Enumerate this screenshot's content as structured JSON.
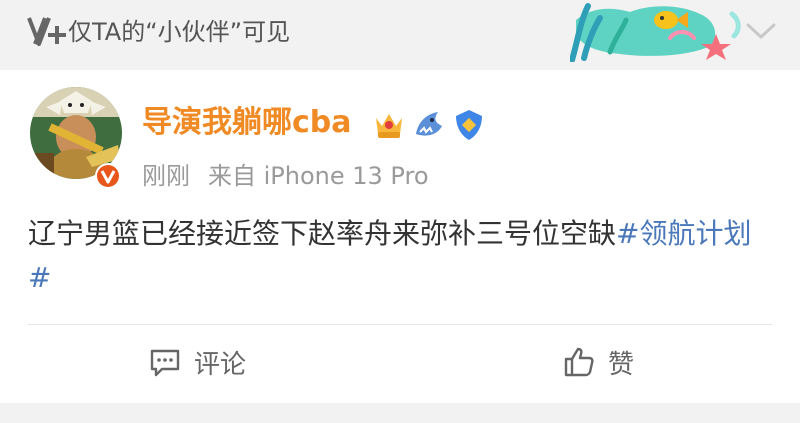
{
  "header": {
    "visibility_label": "仅TA的“小伙伴”可见"
  },
  "post": {
    "author": "导演我躺哪cba",
    "time": "刚刚",
    "source": "来自 iPhone 13 Pro",
    "text": "辽宁男篮已经接近签下赵率舟来弥补三号位空缺",
    "hashtag": "#领航计划#"
  },
  "actions": {
    "comment_label": "评论",
    "like_label": "赞"
  },
  "icons": {
    "visibility": "eye-v-plus-icon",
    "decor": "fish-coral-decoration",
    "chevron": "chevron-down-icon",
    "verified": "verified-v-icon",
    "badge_1": "crown-badge-icon",
    "badge_2": "shark-badge-icon",
    "badge_3": "shield-badge-icon",
    "comment": "comment-icon",
    "like": "thumbs-up-icon"
  },
  "colors": {
    "author": "#f08a24",
    "hashtag": "#4a78b8",
    "meta": "#9a9a9a",
    "verified": "#e8561c"
  }
}
